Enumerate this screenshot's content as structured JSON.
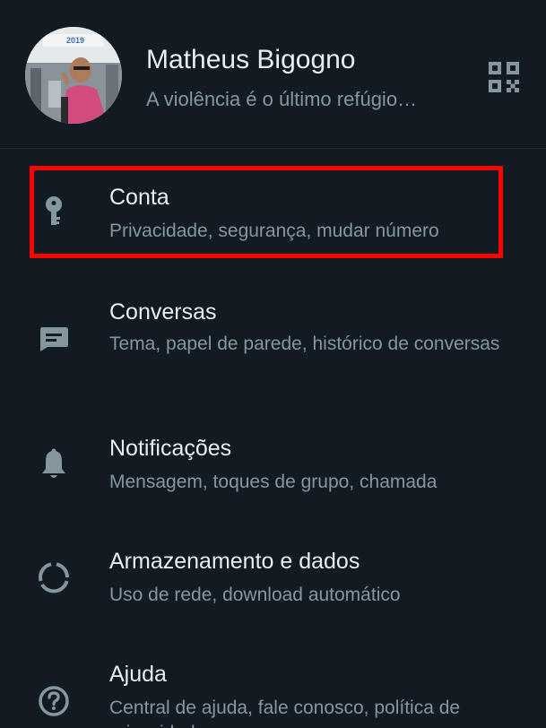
{
  "profile": {
    "name": "Matheus Bigogno",
    "status": "A violência é o último refúgio…",
    "avatar_badge": "2019"
  },
  "qr_icon": "qr-code-icon",
  "items": [
    {
      "icon": "key-icon",
      "title": "Conta",
      "subtitle": "Privacidade, segurança, mudar número"
    },
    {
      "icon": "chat-icon",
      "title": "Conversas",
      "subtitle": "Tema, papel de parede, histórico de conversas"
    },
    {
      "icon": "bell-icon",
      "title": "Notificações",
      "subtitle": "Mensagem, toques de grupo, chamada"
    },
    {
      "icon": "data-usage-icon",
      "title": "Armazenamento e dados",
      "subtitle": "Uso de rede, download automático"
    },
    {
      "icon": "help-icon",
      "title": "Ajuda",
      "subtitle": "Central de ajuda, fale conosco, política de privacidade"
    }
  ],
  "colors": {
    "background": "#111b21",
    "title": "#e9edef",
    "subtitle": "#8696a0",
    "icon": "#8696a0",
    "highlight": "#ff0000"
  }
}
